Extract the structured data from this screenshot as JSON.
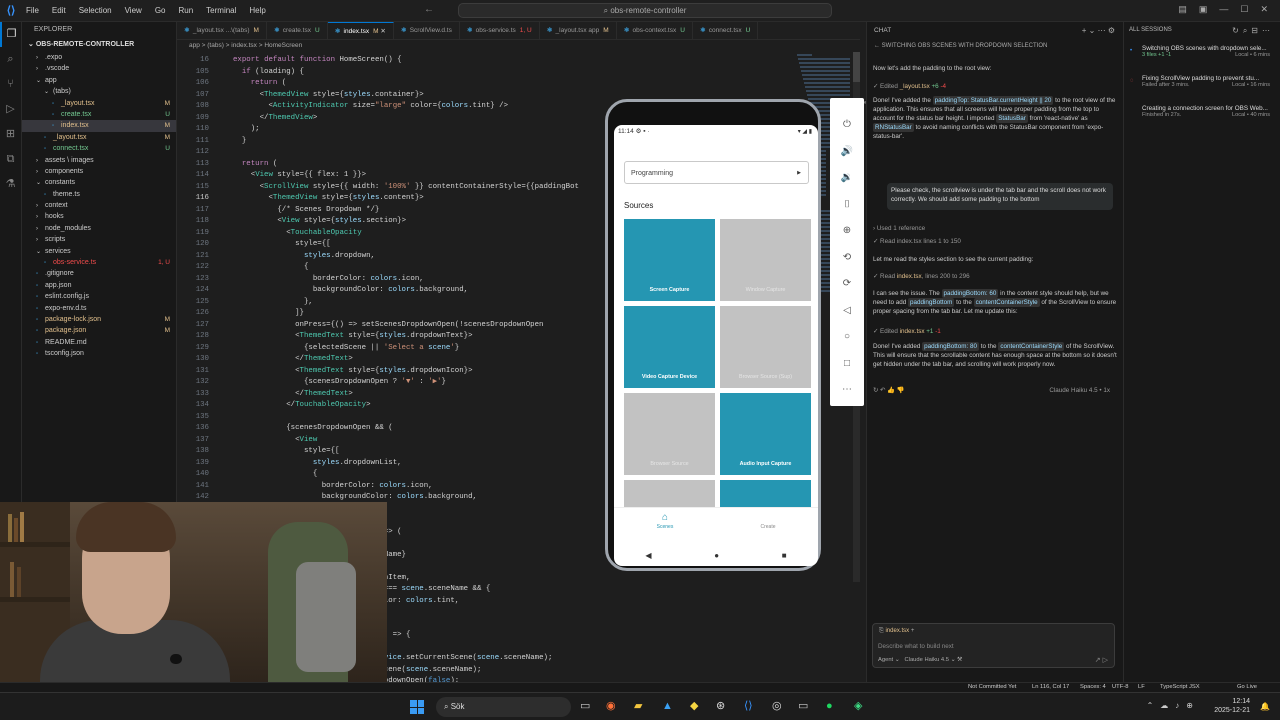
{
  "titlebar": {
    "menu": [
      "File",
      "Edit",
      "Selection",
      "View",
      "Go",
      "Run",
      "Terminal",
      "Help"
    ],
    "command_center": "obs-remote-controller"
  },
  "explorer": {
    "header": "EXPLORER",
    "project": "OBS-REMOTE-CONTROLLER",
    "items": [
      {
        "label": ".expo",
        "indent": 1,
        "type": "folder",
        "status": ""
      },
      {
        "label": ".vscode",
        "indent": 1,
        "type": "folder",
        "status": ""
      },
      {
        "label": "app",
        "indent": 1,
        "type": "folder-open",
        "status": ""
      },
      {
        "label": "(tabs)",
        "indent": 2,
        "type": "folder-open",
        "status": ""
      },
      {
        "label": "_layout.tsx",
        "indent": 3,
        "type": "file",
        "status": "M"
      },
      {
        "label": "create.tsx",
        "indent": 3,
        "type": "file",
        "status": "U"
      },
      {
        "label": "index.tsx",
        "indent": 3,
        "type": "file",
        "status": "M",
        "selected": true
      },
      {
        "label": "_layout.tsx",
        "indent": 2,
        "type": "file",
        "status": "M"
      },
      {
        "label": "connect.tsx",
        "indent": 2,
        "type": "file",
        "status": "U"
      },
      {
        "label": "assets \\ images",
        "indent": 1,
        "type": "folder",
        "status": ""
      },
      {
        "label": "components",
        "indent": 1,
        "type": "folder",
        "status": ""
      },
      {
        "label": "constants",
        "indent": 1,
        "type": "folder-open",
        "status": ""
      },
      {
        "label": "theme.ts",
        "indent": 2,
        "type": "file",
        "status": ""
      },
      {
        "label": "context",
        "indent": 1,
        "type": "folder",
        "status": ""
      },
      {
        "label": "hooks",
        "indent": 1,
        "type": "folder",
        "status": ""
      },
      {
        "label": "node_modules",
        "indent": 1,
        "type": "folder",
        "status": ""
      },
      {
        "label": "scripts",
        "indent": 1,
        "type": "folder",
        "status": ""
      },
      {
        "label": "services",
        "indent": 1,
        "type": "folder-open",
        "status": ""
      },
      {
        "label": "obs-service.ts",
        "indent": 2,
        "type": "file",
        "status": "1, U"
      },
      {
        "label": ".gitignore",
        "indent": 1,
        "type": "file",
        "status": ""
      },
      {
        "label": "app.json",
        "indent": 1,
        "type": "file",
        "status": ""
      },
      {
        "label": "eslint.config.js",
        "indent": 1,
        "type": "file",
        "status": ""
      },
      {
        "label": "expo-env.d.ts",
        "indent": 1,
        "type": "file",
        "status": ""
      },
      {
        "label": "package-lock.json",
        "indent": 1,
        "type": "file",
        "status": "M"
      },
      {
        "label": "package.json",
        "indent": 1,
        "type": "file",
        "status": "M"
      },
      {
        "label": "README.md",
        "indent": 1,
        "type": "file",
        "status": ""
      },
      {
        "label": "tsconfig.json",
        "indent": 1,
        "type": "file",
        "status": ""
      }
    ]
  },
  "tabs": [
    {
      "label": "_layout.tsx  ...\\(tabs)",
      "status": "M",
      "active": false
    },
    {
      "label": "create.tsx",
      "status": "U",
      "active": false
    },
    {
      "label": "index.tsx",
      "status": "M",
      "active": true
    },
    {
      "label": "ScrollView.d.ts",
      "status": "",
      "active": false
    },
    {
      "label": "obs-service.ts",
      "status": "1, U",
      "active": false
    },
    {
      "label": "_layout.tsx  app",
      "status": "M",
      "active": false
    },
    {
      "label": "obs-context.tsx",
      "status": "U",
      "active": false
    },
    {
      "label": "connect.tsx",
      "status": "U",
      "active": false
    }
  ],
  "breadcrumb": "app > (tabs) > index.tsx > HomeScreen",
  "code": {
    "current_line": 116,
    "lines": [
      {
        "n": 16,
        "text": "export default function HomeScreen() {"
      },
      {
        "n": 105,
        "text": "  if (loading) {"
      },
      {
        "n": 106,
        "text": "    return ("
      },
      {
        "n": 107,
        "text": "      <ThemedView style={styles.container}>"
      },
      {
        "n": 108,
        "text": "        <ActivityIndicator size=\"large\" color={colors.tint} />"
      },
      {
        "n": 109,
        "text": "      </ThemedView>"
      },
      {
        "n": 110,
        "text": "    );"
      },
      {
        "n": 111,
        "text": "  }"
      },
      {
        "n": 112,
        "text": ""
      },
      {
        "n": 113,
        "text": "  return ("
      },
      {
        "n": 114,
        "text": "    <View style={{ flex: 1 }}>"
      },
      {
        "n": 115,
        "text": "      <ScrollView style={{ width: '100%' }} contentContainerStyle={{paddingBot"
      },
      {
        "n": 116,
        "text": "        <ThemedView style={styles.content}>"
      },
      {
        "n": 117,
        "text": "          {/* Scenes Dropdown */}"
      },
      {
        "n": 118,
        "text": "          <View style={styles.section}>"
      },
      {
        "n": 119,
        "text": "            <TouchableOpacity"
      },
      {
        "n": 120,
        "text": "              style={["
      },
      {
        "n": 121,
        "text": "                styles.dropdown,"
      },
      {
        "n": 122,
        "text": "                {"
      },
      {
        "n": 123,
        "text": "                  borderColor: colors.icon,"
      },
      {
        "n": 124,
        "text": "                  backgroundColor: colors.background,"
      },
      {
        "n": 125,
        "text": "                },"
      },
      {
        "n": 126,
        "text": "              ]}"
      },
      {
        "n": 127,
        "text": "              onPress={() => setScenesDropdownOpen(!scenesDropdownOpen"
      },
      {
        "n": 128,
        "text": "              <ThemedText style={styles.dropdownText}>"
      },
      {
        "n": 129,
        "text": "                {selectedScene || 'Select a scene'}"
      },
      {
        "n": 130,
        "text": "              </ThemedText>"
      },
      {
        "n": 131,
        "text": "              <ThemedText style={styles.dropdownIcon}>"
      },
      {
        "n": 132,
        "text": "                {scenesDropdownOpen ? '▼' : '▶'}"
      },
      {
        "n": 133,
        "text": "              </ThemedText>"
      },
      {
        "n": 134,
        "text": "            </TouchableOpacity>"
      },
      {
        "n": 135,
        "text": ""
      },
      {
        "n": 136,
        "text": "            {scenesDropdownOpen && ("
      },
      {
        "n": 137,
        "text": "              <View"
      },
      {
        "n": 138,
        "text": "                style={["
      },
      {
        "n": 139,
        "text": "                  styles.dropdownList,"
      },
      {
        "n": 140,
        "text": "                  {"
      },
      {
        "n": 141,
        "text": "                    borderColor: colors.icon,"
      },
      {
        "n": 142,
        "text": "                    backgroundColor: colors.background,"
      },
      {
        "n": 143,
        "text": "                  },"
      },
      {
        "n": 144,
        "text": ""
      },
      {
        "n": 145,
        "text": "              {scenes.map((scene) => ("
      },
      {
        "n": 146,
        "text": "                <TouchableOpacity"
      },
      {
        "n": 147,
        "text": "                  key={scene.sceneName}"
      },
      {
        "n": 148,
        "text": "                  style={["
      },
      {
        "n": 149,
        "text": "                    styles.dropdownItem,"
      },
      {
        "n": 150,
        "text": "                    selectedScene === scene.sceneName && {"
      },
      {
        "n": 151,
        "text": "                      backgroundColor: colors.tint,"
      },
      {
        "n": 152,
        "text": "                    },"
      },
      {
        "n": 153,
        "text": "                  ]}"
      },
      {
        "n": 154,
        "text": "                  onPress={async () => {"
      },
      {
        "n": 155,
        "text": "                    try {"
      },
      {
        "n": 156,
        "text": "                      await obsService.setCurrentScene(scene.sceneName);"
      },
      {
        "n": 157,
        "text": "                      setSelectedScene(scene.sceneName);"
      },
      {
        "n": 158,
        "text": "                      setScenesDropdownOpen(false);"
      }
    ]
  },
  "emulator": {
    "time": "11:14",
    "dropdown_value": "Programming",
    "dropdown_arrow": "▶",
    "sources_title": "Sources",
    "tiles": [
      {
        "label": "Screen Capture",
        "active": true
      },
      {
        "label": "Window Capture",
        "active": false
      },
      {
        "label": "Video Capture Device",
        "active": true
      },
      {
        "label": "Browser Source (Sup)",
        "active": false
      },
      {
        "label": "Browser Source",
        "active": false
      },
      {
        "label": "Audio Input Capture",
        "active": true
      },
      {
        "label": "",
        "active": false
      },
      {
        "label": "",
        "active": true
      }
    ],
    "tab_scenes": "Scenes",
    "tab_create": "Create"
  },
  "chat": {
    "header": "CHAT",
    "title": "SWITCHING OBS SCENES WITH DROPDOWN SELECTION",
    "intro": "Now let's add the padding to the root view:",
    "edit1_file": "_layout.tsx",
    "edit1_add": "+6",
    "edit1_del": "-4",
    "done1_a": "Done! I've added the",
    "done1_code1": "paddingTop: StatusBar.currentHeight || 20",
    "done1_b": "to the root view of the application. This ensures that all screens will have proper padding from the top to account for the status bar height. I imported",
    "done1_code2": "StatusBar",
    "done1_c": "from 'react-native' as",
    "done1_code3": "RNStatusBar",
    "done1_d": "to avoid naming conflicts with the StatusBar component from 'expo-status-bar'.",
    "user_msg": "Please check, the scrollview is under the tab bar and the scroll does not work correctly. We should add some padding to the bottom",
    "used_ref": "Used 1 reference",
    "read1": "Read index.tsx lines 1 to 150",
    "read_intro": "Let me read the styles section to see the current padding:",
    "read2_file": "index.tsx",
    "read2_range": "lines 200 to 296",
    "issue_a": "I can see the issue. The",
    "issue_code1": "paddingBottom: 60",
    "issue_b": "in the content style should help, but we need to add",
    "issue_code2": "paddingBottom",
    "issue_c": "to the",
    "issue_code3": "contentContainerStyle",
    "issue_d": "of the ScrollView to ensure proper spacing from the tab bar. Let me update this:",
    "edit2_file": "index.tsx",
    "edit2_add": "+1",
    "edit2_del": "-1",
    "done2_a": "Done! I've added",
    "done2_code1": "paddingBottom: 80",
    "done2_b": "to the",
    "done2_code2": "contentContainerStyle",
    "done2_c": "of the ScrollView. This will ensure that the scrollable content has enough space at the bottom so it doesn't get hidden under the tab bar, and scrolling will work properly now.",
    "model_tag": "Claude Haiku 4.5 • 1x",
    "input_context": "index.tsx",
    "input_placeholder": "Describe what to build next",
    "agent_label": "Agent",
    "model_label": "Claude Haiku 4.5"
  },
  "sessions": {
    "header": "ALL SESSIONS",
    "items": [
      {
        "title": "Switching OBS scenes with dropdown sele...",
        "meta_left": "3 files +1 -1",
        "meta_right": "Local • 6 mins",
        "icon": "•"
      },
      {
        "title": "Fixing ScrollView padding to prevent stu...",
        "meta_left": "Failed after 3 mins.",
        "meta_right": "Local • 16 mins",
        "icon": "◌"
      },
      {
        "title": "Creating a connection screen for OBS Web...",
        "meta_left": "Finished in 27s.",
        "meta_right": "Local • 40 mins",
        "icon": ""
      }
    ]
  },
  "statusbar": {
    "git": "Not Committed Yet",
    "position": "Ln 116, Col 17",
    "spaces": "Spaces: 4",
    "encoding": "UTF-8",
    "eol": "LF",
    "language": "TypeScript JSX",
    "live": "Go Live"
  },
  "taskbar": {
    "search": "Sök",
    "time": "12:14",
    "date": "2025-12-21"
  }
}
